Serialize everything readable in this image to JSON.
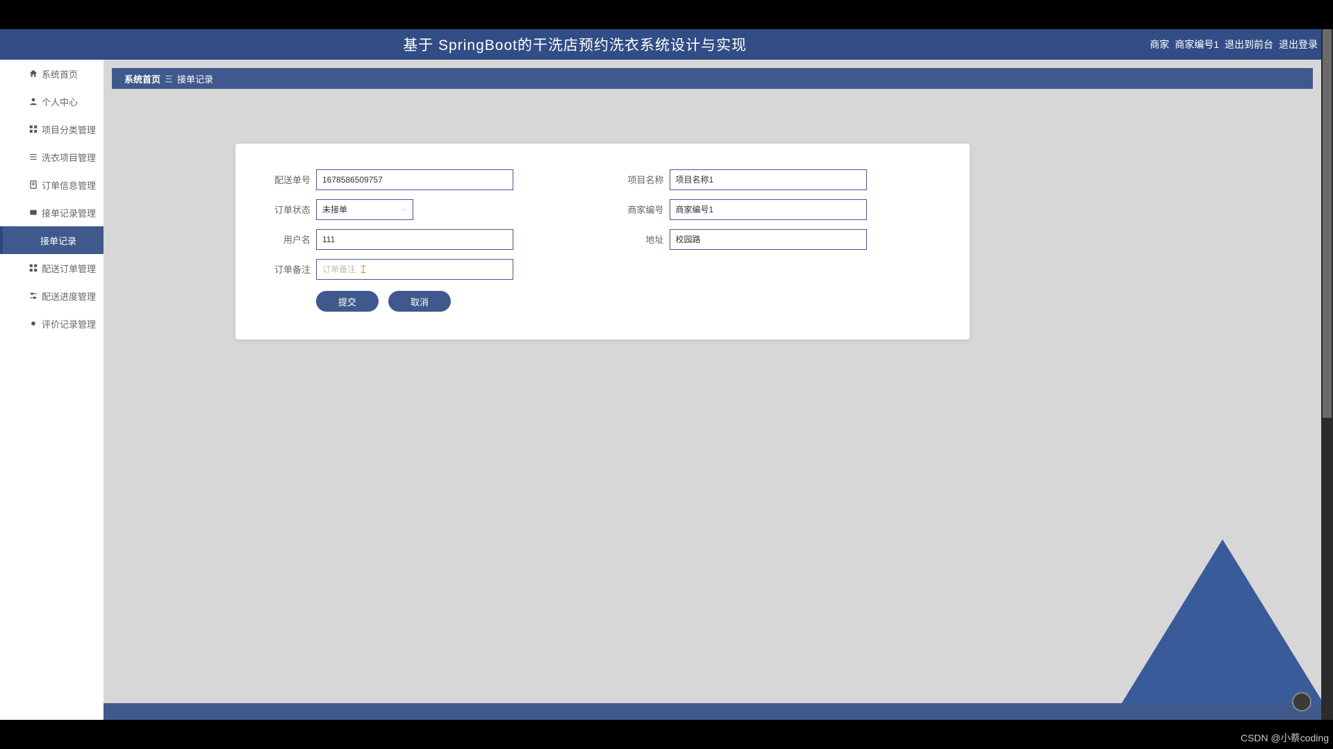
{
  "header": {
    "title": "基于 SpringBoot的干洗店预约洗衣系统设计与实现",
    "role": "商家",
    "user": "商家编号1",
    "link_front": "退出到前台",
    "link_logout": "退出登录"
  },
  "sidebar": {
    "items": [
      {
        "label": "系统首页",
        "icon": "home"
      },
      {
        "label": "个人中心",
        "icon": "person"
      },
      {
        "label": "项目分类管理",
        "icon": "grid"
      },
      {
        "label": "洗衣项目管理",
        "icon": "list"
      },
      {
        "label": "订单信息管理",
        "icon": "doc"
      },
      {
        "label": "接单记录管理",
        "icon": "record",
        "expanded": true,
        "sub": "接单记录"
      },
      {
        "label": "配送订单管理",
        "icon": "grid"
      },
      {
        "label": "配送进度管理",
        "icon": "sliders"
      },
      {
        "label": "评价记录管理",
        "icon": "dot"
      }
    ]
  },
  "breadcrumb": {
    "home": "系统首页",
    "sep": "三",
    "current": "接单记录"
  },
  "form": {
    "labels": {
      "delivery_no": "配送单号",
      "project_name": "项目名称",
      "order_status": "订单状态",
      "merchant_no": "商家编号",
      "username": "用户名",
      "address": "地址",
      "order_remark": "订单备注"
    },
    "values": {
      "delivery_no": "1678586509757",
      "project_name": "项目名称1",
      "order_status": "未接单",
      "merchant_no": "商家编号1",
      "username": "111",
      "address": "校园路",
      "order_remark": ""
    },
    "placeholders": {
      "order_remark": "订单备注"
    },
    "buttons": {
      "submit": "提交",
      "cancel": "取消"
    }
  },
  "watermark": "CSDN @小蔡coding"
}
